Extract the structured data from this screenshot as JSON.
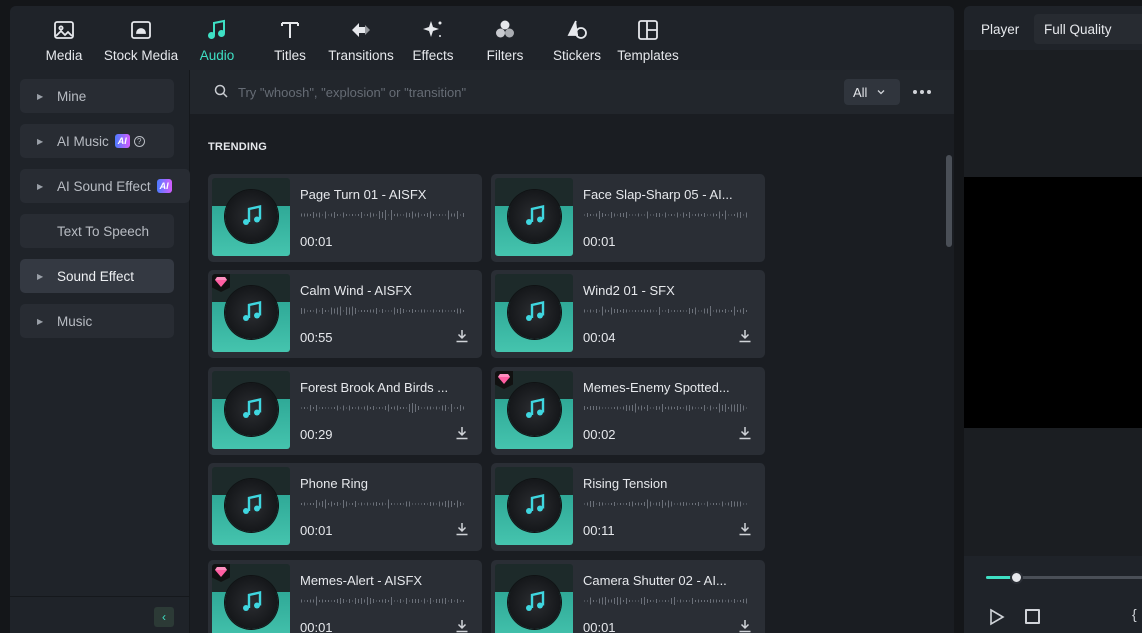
{
  "toolbar": {
    "items": [
      {
        "label": "Media",
        "icon": "media-icon"
      },
      {
        "label": "Stock Media",
        "icon": "stock-media-icon"
      },
      {
        "label": "Audio",
        "icon": "audio-note-icon",
        "active": true
      },
      {
        "label": "Titles",
        "icon": "titles-icon"
      },
      {
        "label": "Transitions",
        "icon": "transitions-icon"
      },
      {
        "label": "Effects",
        "icon": "effects-icon"
      },
      {
        "label": "Filters",
        "icon": "filters-icon"
      },
      {
        "label": "Stickers",
        "icon": "stickers-icon"
      },
      {
        "label": "Templates",
        "icon": "templates-icon"
      }
    ]
  },
  "sidebar": {
    "items": [
      {
        "label": "Mine"
      },
      {
        "label": "AI Music",
        "badge": "AI"
      },
      {
        "label": "AI Sound Effect",
        "badge": "AI"
      },
      {
        "label": "Text To Speech"
      },
      {
        "label": "Sound Effect",
        "active": true
      },
      {
        "label": "Music"
      }
    ]
  },
  "search": {
    "placeholder": "Try \"whoosh\", \"explosion\" or \"transition\"",
    "filter_value": "All"
  },
  "section": {
    "title": "TRENDING"
  },
  "cards": [
    {
      "title": "Page Turn 01 - AISFX",
      "duration": "00:01",
      "premium": false,
      "download": false
    },
    {
      "title": "Face Slap-Sharp 05 - AI...",
      "duration": "00:01",
      "premium": false,
      "download": false
    },
    {
      "title": "Calm Wind - AISFX",
      "duration": "00:55",
      "premium": true,
      "download": true
    },
    {
      "title": "Wind2 01 - SFX",
      "duration": "00:04",
      "premium": false,
      "download": true
    },
    {
      "title": "Forest Brook And Birds ...",
      "duration": "00:29",
      "premium": false,
      "download": true
    },
    {
      "title": "Memes-Enemy Spotted...",
      "duration": "00:02",
      "premium": true,
      "download": true
    },
    {
      "title": "Phone Ring",
      "duration": "00:01",
      "premium": false,
      "download": true
    },
    {
      "title": "Rising Tension",
      "duration": "00:11",
      "premium": false,
      "download": true
    },
    {
      "title": "Memes-Alert - AISFX",
      "duration": "00:01",
      "premium": true,
      "download": true
    },
    {
      "title": "Camera Shutter 02 - AI...",
      "duration": "00:01",
      "premium": false,
      "download": true
    }
  ],
  "player": {
    "tab_label": "Player",
    "quality": "Full Quality",
    "progress": 0.19
  },
  "colors": {
    "accent": "#3ee0c4",
    "panel": "#1f2329",
    "card": "#2a2e35"
  }
}
